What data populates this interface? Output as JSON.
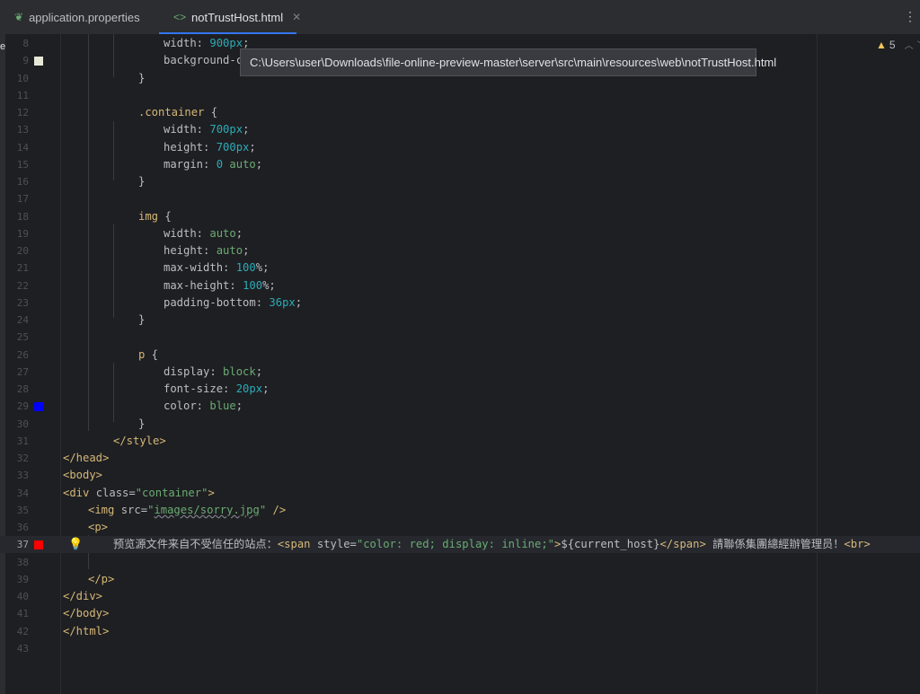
{
  "tabs": [
    {
      "label": "application.properties",
      "icon": "leaf-icon",
      "active": false
    },
    {
      "label": "notTrustHost.html",
      "icon": "html-icon",
      "active": true
    }
  ],
  "tooltip_path": "C:\\Users\\user\\Downloads\\file-online-preview-master\\server\\src\\main\\resources\\web\\notTrustHost.html",
  "inspections": {
    "warning_count": "5"
  },
  "colors": {
    "marker_9": "#e8e8d8",
    "marker_29": "#0000ff",
    "marker_37": "#ff0000",
    "accent": "#3574f0"
  },
  "line_numbers": [
    "8",
    "9",
    "10",
    "11",
    "12",
    "13",
    "14",
    "15",
    "16",
    "17",
    "18",
    "19",
    "20",
    "21",
    "22",
    "23",
    "24",
    "25",
    "26",
    "27",
    "28",
    "29",
    "30",
    "31",
    "32",
    "33",
    "34",
    "35",
    "36",
    "37",
    "38",
    "39",
    "40",
    "41",
    "42",
    "43"
  ],
  "code": {
    "l8": [
      "width: ",
      "900px",
      ";"
    ],
    "l9": [
      "background-color"
    ],
    "l10": [
      "}"
    ],
    "l12": [
      ".container",
      " {"
    ],
    "l13": [
      "width: ",
      "700px",
      ";"
    ],
    "l14": [
      "height: ",
      "700px",
      ";"
    ],
    "l15": [
      "margin: ",
      "0",
      " ",
      "auto",
      ";"
    ],
    "l16": [
      "}"
    ],
    "l18": [
      "img",
      " {"
    ],
    "l19": [
      "width: ",
      "auto",
      ";"
    ],
    "l20": [
      "height: ",
      "auto",
      ";"
    ],
    "l21": [
      "max-width: ",
      "100",
      "%;"
    ],
    "l22": [
      "max-height: ",
      "100",
      "%;"
    ],
    "l23": [
      "padding-bottom: ",
      "36px",
      ";"
    ],
    "l24": [
      "}"
    ],
    "l26": [
      "p",
      " {"
    ],
    "l27": [
      "display: ",
      "block",
      ";"
    ],
    "l28": [
      "font-size: ",
      "20px",
      ";"
    ],
    "l29": [
      "color: ",
      "blue",
      ";"
    ],
    "l30": [
      "}"
    ],
    "l31": [
      "</style>"
    ],
    "l32": [
      "</head>"
    ],
    "l33": [
      "<body>"
    ],
    "l34": [
      "<div ",
      "class",
      "=",
      "\"container\"",
      ">"
    ],
    "l35": [
      "<",
      "img",
      " ",
      "src",
      "=",
      "\"",
      "images/sorry.jpg",
      "\"",
      " />"
    ],
    "l36": [
      "<p>"
    ],
    "l37": [
      "预览源文件来自不受信任的站点：",
      "<span ",
      "style",
      "=",
      "\"color: ",
      "red",
      "; display: ",
      "inline",
      ";\"",
      ">",
      "${current_host}",
      "</span>",
      " 請聯係集團總經辦管理员！",
      "<br>"
    ],
    "l39": [
      "</p>"
    ],
    "l40": [
      "</div>"
    ],
    "l41": [
      "</body>"
    ],
    "l42": [
      "</html>"
    ]
  }
}
